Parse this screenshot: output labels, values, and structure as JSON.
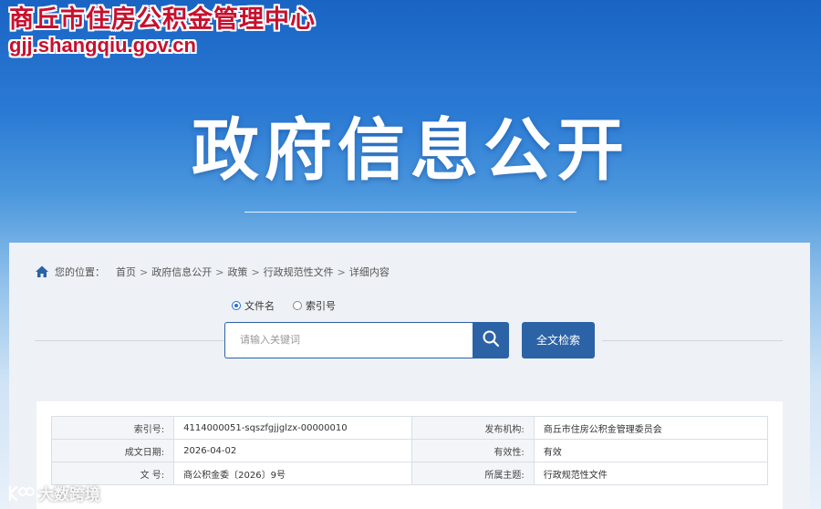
{
  "header": {
    "site_name": "商丘市住房公积金管理中心",
    "site_url": "gjj.shangqiu.gov.cn",
    "hero_title": "政府信息公开"
  },
  "breadcrumb": {
    "prefix": "您的位置：",
    "items": [
      "首页",
      "政府信息公开",
      "政策",
      "行政规范性文件",
      "详细内容"
    ],
    "separator": ">"
  },
  "search": {
    "options": [
      {
        "label": "文件名",
        "selected": true
      },
      {
        "label": "索引号",
        "selected": false
      }
    ],
    "placeholder": "请输入关键词",
    "fulltext_label": "全文检索"
  },
  "info": {
    "rows": [
      {
        "label1": "索引号:",
        "value1": "4114000051-sqszfgjjglzx-00000010",
        "label2": "发布机构:",
        "value2": "商丘市住房公积金管理委员会"
      },
      {
        "label1": "成文日期:",
        "value1": "2026-04-02",
        "label2": "有效性:",
        "value2": "有效"
      },
      {
        "label1": "文 号:",
        "value1": "商公积金委〔2026〕9号",
        "label2": "所属主题:",
        "value2": "行政规范性文件"
      }
    ]
  },
  "watermark": {
    "text": "大数跨境"
  },
  "colors": {
    "brand_red": "#c8102e",
    "primary_blue": "#2c63a6"
  }
}
